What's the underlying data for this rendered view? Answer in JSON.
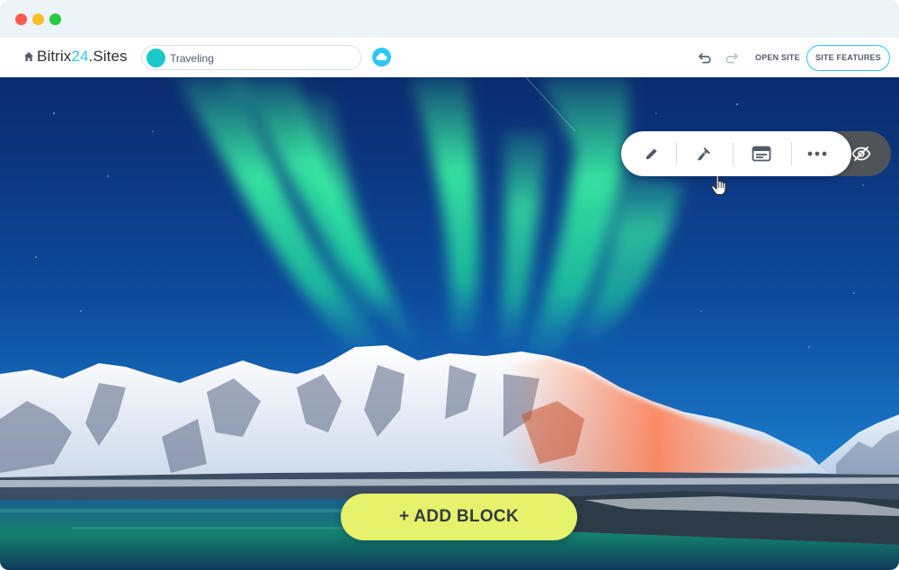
{
  "window": {
    "controls": [
      "close",
      "minimize",
      "maximize"
    ]
  },
  "topbar": {
    "brand_prefix": "Bitrix",
    "brand_number": "24",
    "brand_suffix": ".Sites",
    "site_name": "Traveling",
    "open_site_label": "OPEN SITE",
    "site_features_label": "SITE FEATURES"
  },
  "block_toolbar": {
    "buttons": [
      {
        "icon": "pencil-icon"
      },
      {
        "icon": "brush-icon"
      },
      {
        "icon": "browser-window-icon"
      },
      {
        "icon": "more-dots-icon"
      },
      {
        "icon": "eye-hidden-icon"
      }
    ]
  },
  "add_block": {
    "label": "+ ADD BLOCK"
  },
  "colors": {
    "accent": "#2fc6f6",
    "add_block_bg": "#e6f26b",
    "titlebar": "#edf4f8"
  }
}
